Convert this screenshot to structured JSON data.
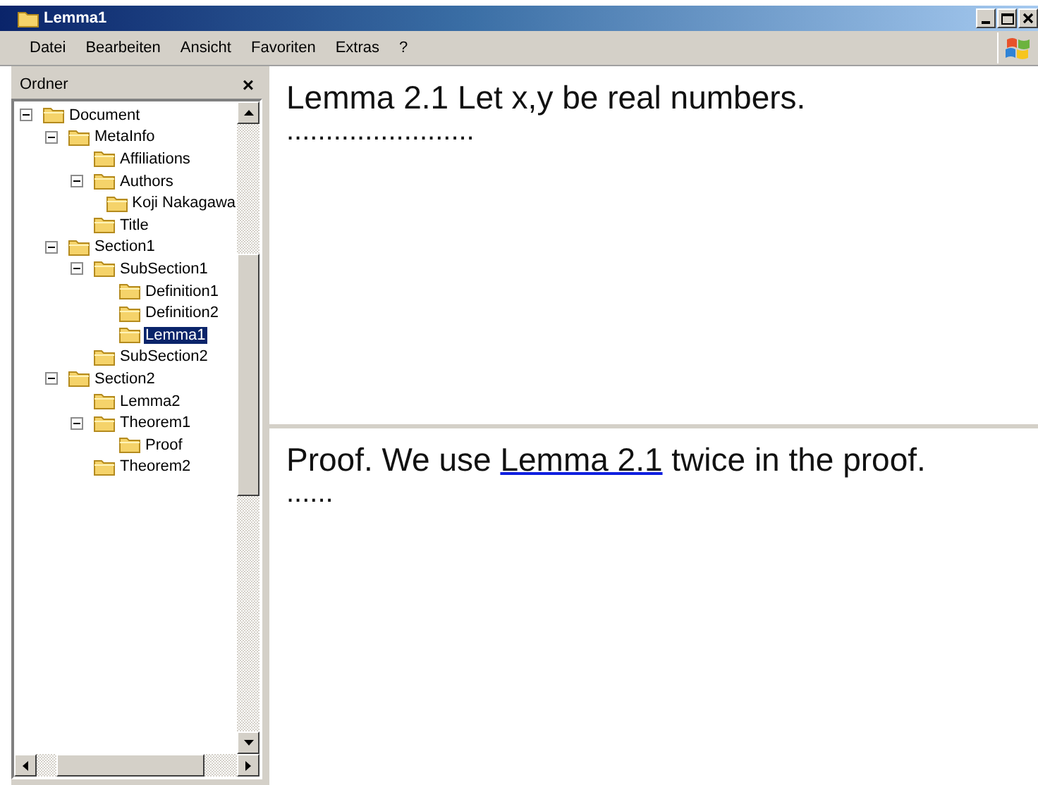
{
  "window": {
    "title": "Lemma1"
  },
  "menu": [
    "Datei",
    "Bearbeiten",
    "Ansicht",
    "Favoriten",
    "Extras",
    "?"
  ],
  "sidebar": {
    "title": "Ordner",
    "close": "×",
    "tree": [
      {
        "label": "Document",
        "expanded": true,
        "selected": false,
        "children": [
          {
            "label": "MetaInfo",
            "expanded": true,
            "selected": false,
            "children": [
              {
                "label": "Affiliations",
                "selected": false
              },
              {
                "label": "Authors",
                "expanded": true,
                "selected": false,
                "children": [
                  {
                    "label": "Koji Nakagawa",
                    "selected": false
                  }
                ]
              },
              {
                "label": "Title",
                "selected": false
              }
            ]
          },
          {
            "label": "Section1",
            "expanded": true,
            "selected": false,
            "children": [
              {
                "label": "SubSection1",
                "expanded": true,
                "selected": false,
                "children": [
                  {
                    "label": "Definition1",
                    "selected": false
                  },
                  {
                    "label": "Definition2",
                    "selected": false
                  },
                  {
                    "label": "Lemma1",
                    "selected": true
                  }
                ]
              },
              {
                "label": "SubSection2",
                "selected": false
              }
            ]
          },
          {
            "label": "Section2",
            "expanded": true,
            "selected": false,
            "children": [
              {
                "label": "Lemma2",
                "selected": false
              },
              {
                "label": "Theorem1",
                "expanded": true,
                "selected": false,
                "children": [
                  {
                    "label": "Proof",
                    "selected": false
                  }
                ]
              },
              {
                "label": "Theorem2",
                "selected": false
              }
            ]
          }
        ]
      }
    ]
  },
  "top_pane": {
    "heading": "Lemma 2.1 Let x,y be real numbers.",
    "dots": "........................"
  },
  "bottom_pane": {
    "before": "Proof. We use ",
    "link": "Lemma 2.1",
    "after": " twice in the proof.",
    "dots": "......"
  }
}
